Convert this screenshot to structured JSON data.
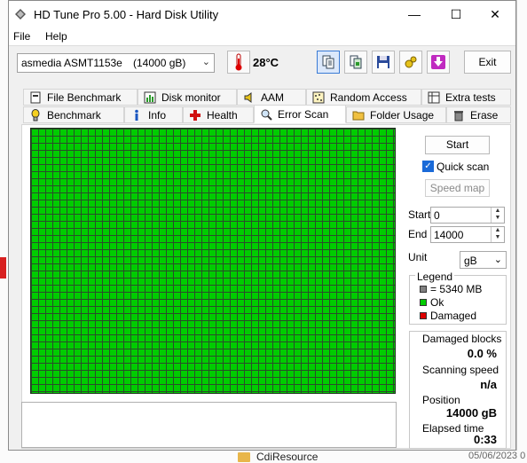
{
  "window": {
    "title": "HD Tune Pro 5.00 - Hard Disk Utility",
    "controls": {
      "minimize": "—",
      "maximize": "☐",
      "close": "✕"
    }
  },
  "menu": [
    {
      "label": "File"
    },
    {
      "label": "Help"
    }
  ],
  "drive": {
    "name": "asmedia ASMT1153e",
    "capacity": "(14000 gB)"
  },
  "temperature": "28°C",
  "toolbar": {
    "exit_label": "Exit"
  },
  "tabs_top": [
    {
      "label": "File Benchmark",
      "icon": "file-benchmark-icon"
    },
    {
      "label": "Disk monitor",
      "icon": "disk-monitor-icon"
    },
    {
      "label": "AAM",
      "icon": "speaker-icon"
    },
    {
      "label": "Random Access",
      "icon": "random-access-icon"
    },
    {
      "label": "Extra tests",
      "icon": "extra-tests-icon"
    }
  ],
  "tabs_bottom": [
    {
      "label": "Benchmark",
      "icon": "benchmark-icon"
    },
    {
      "label": "Info",
      "icon": "info-icon"
    },
    {
      "label": "Health",
      "icon": "health-icon"
    },
    {
      "label": "Error Scan",
      "icon": "error-scan-icon",
      "active": true
    },
    {
      "label": "Folder Usage",
      "icon": "folder-icon"
    },
    {
      "label": "Erase",
      "icon": "erase-icon"
    }
  ],
  "scan": {
    "start_label": "Start",
    "quick_scan_label": "Quick scan",
    "quick_scan_checked": true,
    "speed_map_label": "Speed map",
    "start_field_label": "Start",
    "start_value": "0",
    "end_field_label": "End",
    "end_value": "14000",
    "unit_label": "Unit",
    "unit_value": "gB"
  },
  "legend": {
    "title": "Legend",
    "items": [
      {
        "label": "= 5340 MB",
        "color": "#808080"
      },
      {
        "label": "Ok",
        "color": "#00cc00"
      },
      {
        "label": "Damaged",
        "color": "#dd0000"
      }
    ]
  },
  "stats": {
    "damaged_label": "Damaged blocks",
    "damaged_value": "0.0 %",
    "speed_label": "Scanning speed",
    "speed_value": "n/a",
    "position_label": "Position",
    "position_value": "14000 gB",
    "elapsed_label": "Elapsed time",
    "elapsed_value": "0:33"
  },
  "grid": {
    "status_color": "#00cc00"
  },
  "background": {
    "folder_label": "CdiResource",
    "date": "05/06/2023 0"
  }
}
